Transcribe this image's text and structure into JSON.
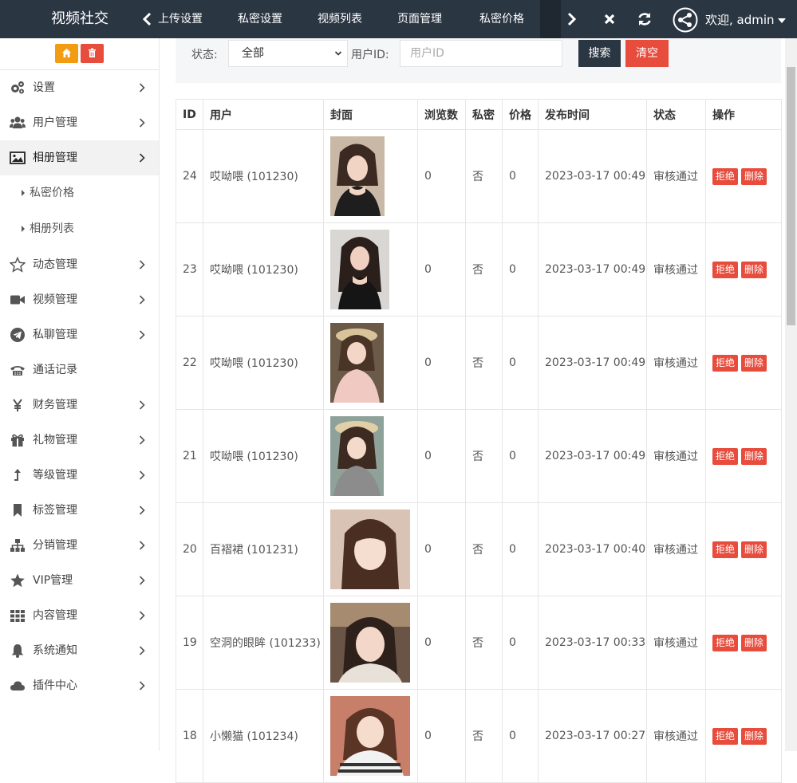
{
  "app": {
    "title": "视频社交"
  },
  "tabs": [
    "上传设置",
    "私密设置",
    "视频列表",
    "页面管理",
    "私密价格"
  ],
  "user": {
    "greeting": "欢迎, admin"
  },
  "sidebar": {
    "items": [
      {
        "label": "设置",
        "icon": "gears-icon"
      },
      {
        "label": "用户管理",
        "icon": "users-icon"
      },
      {
        "label": "相册管理",
        "icon": "picture-icon"
      },
      {
        "label": "私密价格",
        "icon": "caret-icon"
      },
      {
        "label": "相册列表",
        "icon": "caret-icon"
      },
      {
        "label": "动态管理",
        "icon": "star-outline-icon"
      },
      {
        "label": "视频管理",
        "icon": "video-camera-icon"
      },
      {
        "label": "私聊管理",
        "icon": "telegram-icon"
      },
      {
        "label": "通话记录",
        "icon": "phone-icon"
      },
      {
        "label": "财务管理",
        "icon": "yen-icon"
      },
      {
        "label": "礼物管理",
        "icon": "gift-icon"
      },
      {
        "label": "等级管理",
        "icon": "level-up-icon"
      },
      {
        "label": "标签管理",
        "icon": "bookmark-icon"
      },
      {
        "label": "分销管理",
        "icon": "sitemap-icon"
      },
      {
        "label": "VIP管理",
        "icon": "star-icon"
      },
      {
        "label": "内容管理",
        "icon": "grid-icon"
      },
      {
        "label": "系统通知",
        "icon": "bell-icon"
      },
      {
        "label": "插件中心",
        "icon": "cloud-icon"
      }
    ]
  },
  "search": {
    "status_label": "状态:",
    "status_value": "全部",
    "userid_label": "用户ID:",
    "userid_placeholder": "用户ID",
    "search_btn": "搜索",
    "clear_btn": "清空"
  },
  "table": {
    "headers": [
      "ID",
      "用户",
      "封面",
      "浏览数",
      "私密",
      "价格",
      "发布时间",
      "状态",
      "操作"
    ],
    "reject_label": "拒绝",
    "delete_label": "删除",
    "rows": [
      {
        "id": "24",
        "user": "哎呦喂 (101230)",
        "views": "0",
        "private": "否",
        "price": "0",
        "time": "2023-03-17 00:49",
        "status": "审核通过"
      },
      {
        "id": "23",
        "user": "哎呦喂 (101230)",
        "views": "0",
        "private": "否",
        "price": "0",
        "time": "2023-03-17 00:49",
        "status": "审核通过"
      },
      {
        "id": "22",
        "user": "哎呦喂 (101230)",
        "views": "0",
        "private": "否",
        "price": "0",
        "time": "2023-03-17 00:49",
        "status": "审核通过"
      },
      {
        "id": "21",
        "user": "哎呦喂 (101230)",
        "views": "0",
        "private": "否",
        "price": "0",
        "time": "2023-03-17 00:49",
        "status": "审核通过"
      },
      {
        "id": "20",
        "user": "百褶裙 (101231)",
        "views": "0",
        "private": "否",
        "price": "0",
        "time": "2023-03-17 00:40",
        "status": "审核通过"
      },
      {
        "id": "19",
        "user": "空洞的眼眸 (101233)",
        "views": "0",
        "private": "否",
        "price": "0",
        "time": "2023-03-17 00:33",
        "status": "审核通过"
      },
      {
        "id": "18",
        "user": "小懒猫 (101234)",
        "views": "0",
        "private": "否",
        "price": "0",
        "time": "2023-03-17 00:27",
        "status": "审核通过"
      }
    ]
  },
  "colors": {
    "topbar": "#2b3643",
    "accent_red": "#e74c3c",
    "accent_orange": "#f39c12"
  }
}
